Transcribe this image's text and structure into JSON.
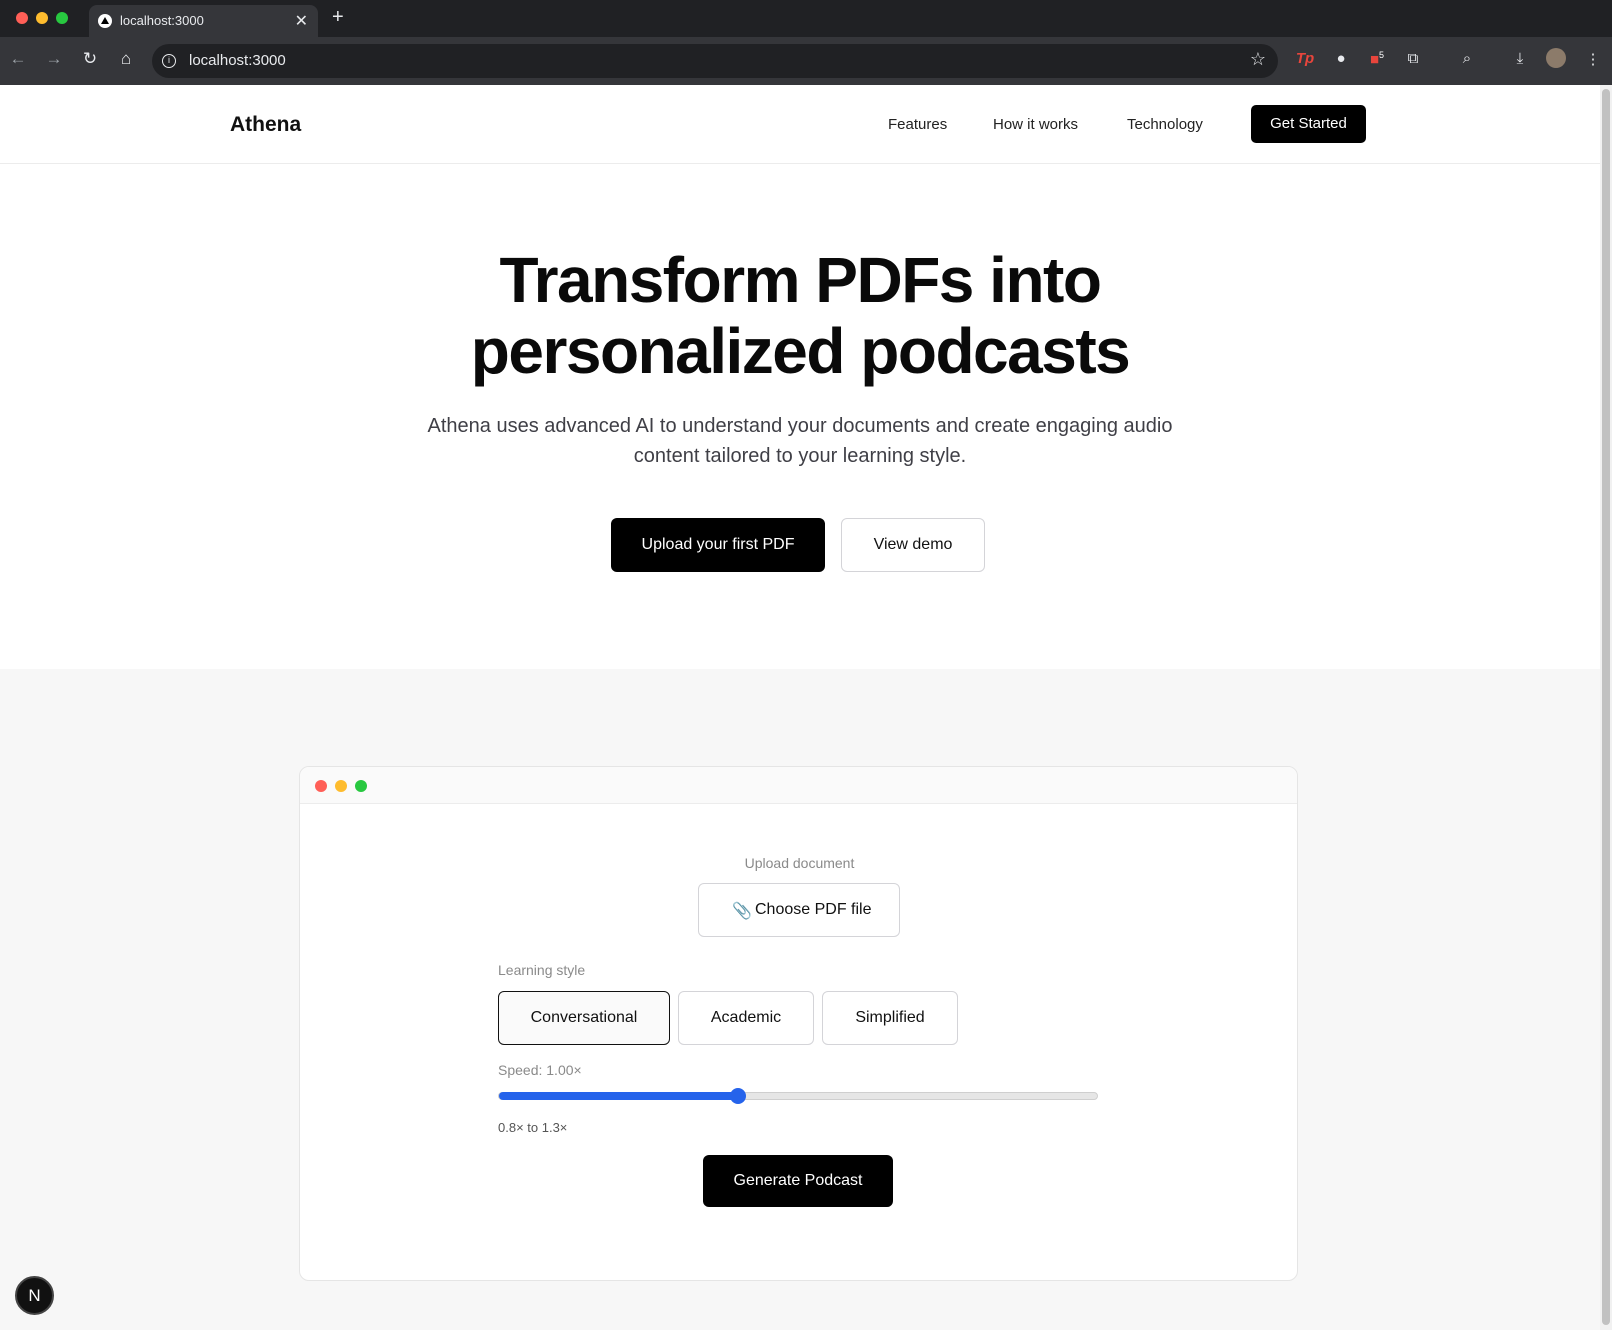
{
  "browser": {
    "tab_title": "localhost:3000",
    "tab_close": "✕",
    "new_tab": "+",
    "url": "localhost:3000",
    "back": "←",
    "forward": "→",
    "reload": "↻",
    "home": "⌂",
    "star": "☆",
    "menu": "⋮",
    "extension_badge": "5",
    "icons": [
      "back-icon",
      "forward-icon",
      "reload-icon",
      "home-icon",
      "info-icon",
      "star-icon",
      "extension-tp-icon",
      "extension-circle-icon",
      "extension-shield-icon",
      "puzzle-icon",
      "tab-search-icon",
      "download-icon",
      "profile-avatar",
      "kebab-menu-icon"
    ]
  },
  "header": {
    "logo": "Athena",
    "nav": [
      "Features",
      "How it works",
      "Technology"
    ],
    "cta": "Get Started"
  },
  "hero": {
    "title_line1": "Transform PDFs into",
    "title_line2": "personalized podcasts",
    "subtitle": "Athena uses advanced AI to understand your documents and create engaging audio content tailored to your learning style.",
    "primary_button": "Upload your first PDF",
    "secondary_button": "View demo"
  },
  "demo": {
    "upload_label": "Upload document",
    "choose_file": "Choose PDF file",
    "learning_style_label": "Learning style",
    "styles": [
      "Conversational",
      "Academic",
      "Simplified"
    ],
    "selected_style": "Conversational",
    "speed_label": "Speed: 1.00×",
    "speed_value": 1.0,
    "speed_min": 0.8,
    "speed_max": 1.3,
    "speed_fraction": 0.4,
    "range_label": "0.8× to 1.3×",
    "generate_button": "Generate Podcast"
  },
  "next_badge": "N",
  "colors": {
    "accent": "#2563eb",
    "primary": "#000000",
    "traffic_red": "#ff5f57",
    "traffic_yellow": "#febc2e",
    "traffic_green": "#28c840"
  }
}
